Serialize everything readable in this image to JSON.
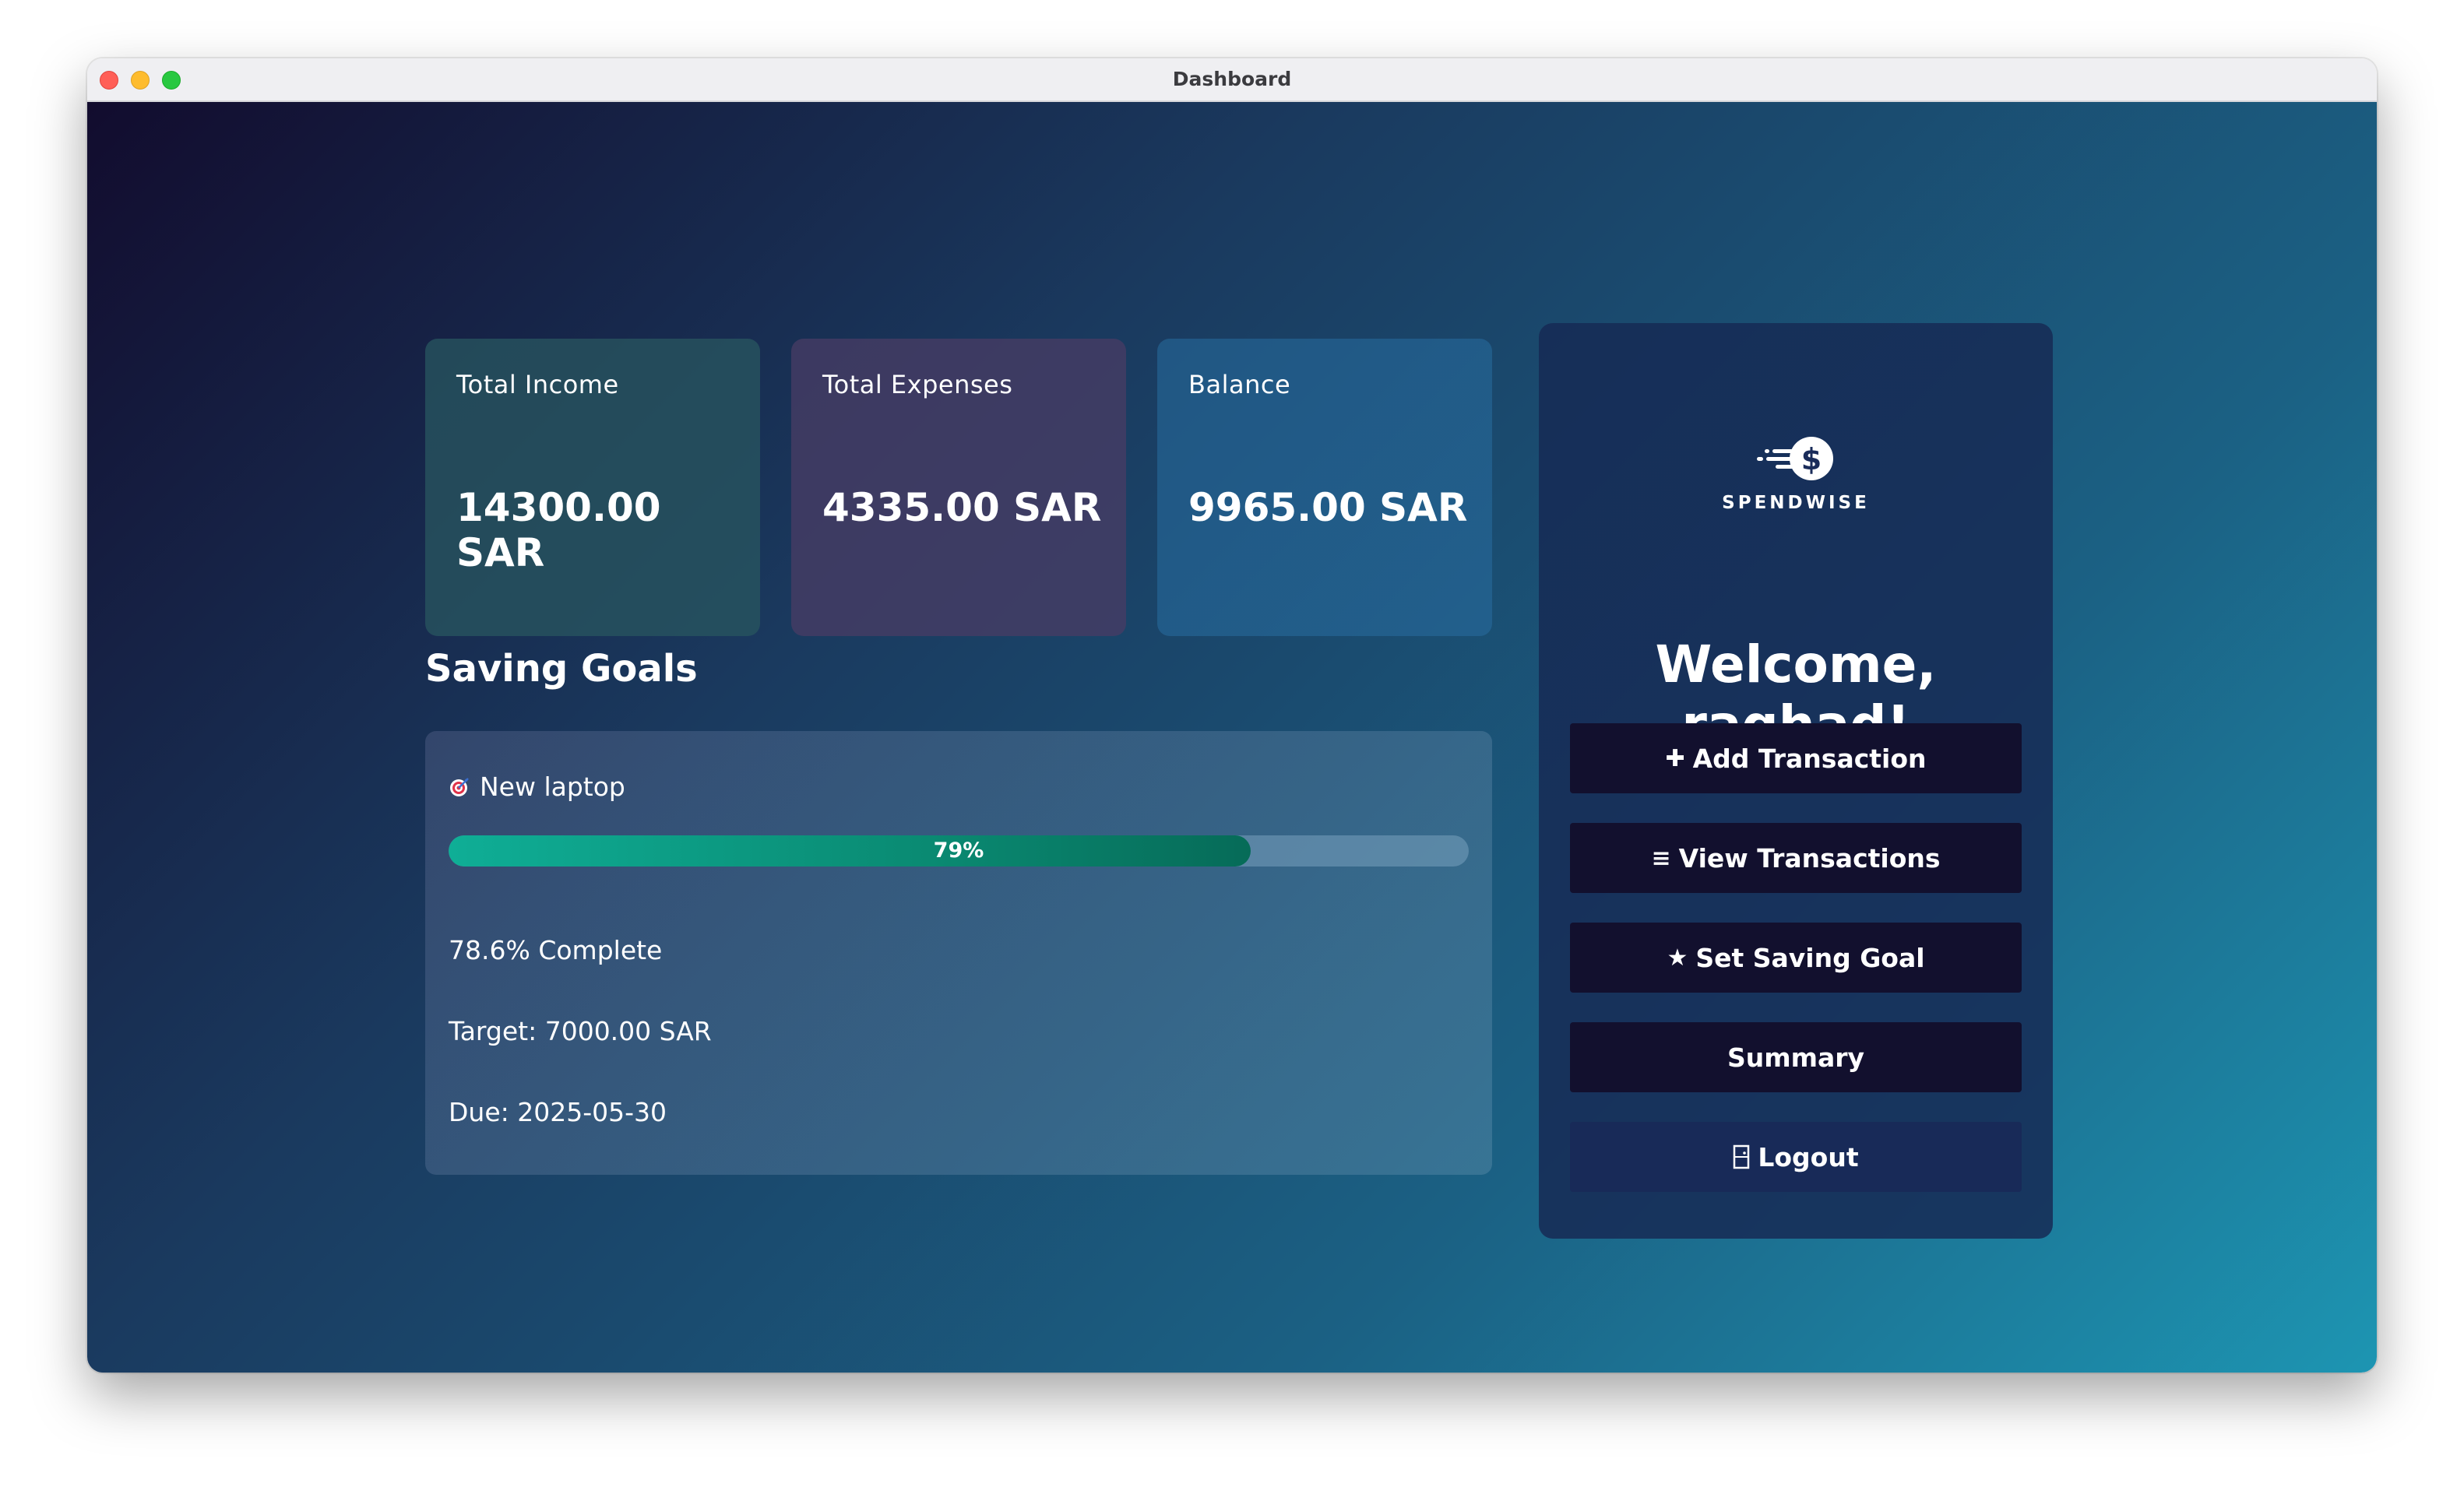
{
  "window": {
    "title": "Dashboard"
  },
  "summary_cards": {
    "income": {
      "label": "Total Income",
      "value": "14300.00 SAR"
    },
    "expenses": {
      "label": "Total Expenses",
      "value": "4335.00 SAR"
    },
    "balance": {
      "label": "Balance",
      "value": "9965.00 SAR"
    }
  },
  "saving_goals": {
    "title": "Saving Goals",
    "goal": {
      "icon": "target-icon",
      "name": "New laptop",
      "progress_label": "79%",
      "progress_fraction": 0.786,
      "complete_text": "78.6% Complete",
      "target_text": "Target: 7000.00 SAR",
      "due_text": "Due: 2025-05-30"
    }
  },
  "sidebar": {
    "logo_text": "SPENDWISE",
    "welcome": "Welcome, raghad!",
    "buttons": {
      "add_transaction": {
        "icon": "plus-icon",
        "glyph": "✚",
        "label": "Add Transaction"
      },
      "view_transactions": {
        "icon": "list-icon",
        "glyph": "≡",
        "label": "View Transactions"
      },
      "set_saving_goal": {
        "icon": "star-icon",
        "glyph": "★",
        "label": "Set Saving Goal"
      },
      "summary": {
        "label": "Summary"
      },
      "logout": {
        "icon": "door-icon",
        "label": "Logout"
      }
    }
  },
  "colors": {
    "progress_fill": "#0fae96",
    "button_bg": "#12102e",
    "logout_bg": "#182a58"
  }
}
